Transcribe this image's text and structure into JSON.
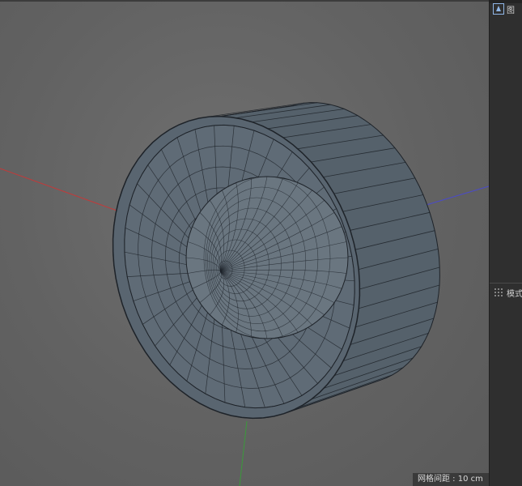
{
  "viewport": {
    "grid_spacing_label": "网格间距 : 10 cm",
    "colors": {
      "background": "#636363",
      "mesh_fill": "#5a6670",
      "mesh_wire": "#1e2329",
      "axis_x": "#c23a3a",
      "axis_y": "#3a9a3a",
      "axis_z": "#4a4acc"
    }
  },
  "right_panel": {
    "top_tab": {
      "label": "图",
      "icon": "object-manager-icon"
    },
    "mid_tab": {
      "label": "模式",
      "icon": "grip-dots-icon"
    }
  }
}
